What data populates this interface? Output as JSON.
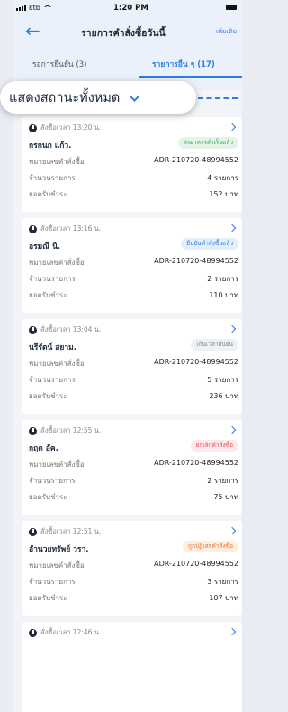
{
  "status_bar": {
    "carrier": "ktb",
    "time": "1:20 PM"
  },
  "nav": {
    "title": "รายการคำสั่งซื้อวันนี้",
    "add_label": "เพิ่มเติม"
  },
  "tabs": [
    {
      "label": "รอการยืนยัน (3)"
    },
    {
      "label": "รายการอื่น ๆ (17)"
    }
  ],
  "filter": {
    "label": "แสดงสถานะทั้งหมด"
  },
  "field_labels": {
    "order_no": "หมายเลขคำสั่งซื้อ",
    "item_count": "จำนวนรายการ",
    "total": "ยอดรับชำระ"
  },
  "orders": [
    {
      "time": "สั่งซื้อเวลา 13:20 น.",
      "name": "กรกนก แก้ว.",
      "status": "ส่งอาหารสำเร็จแล้ว",
      "status_color": "#2eaa5c",
      "status_bg": "#e3f5e9",
      "order_no": "ADR-210720-48994552",
      "items": "4 รายการ",
      "total": "152 บาท"
    },
    {
      "time": "สั่งซื้อเวลา 13:16 น.",
      "name": "อรมณี นิ.",
      "status": "ยืนยันคำสั่งซื้อแล้ว",
      "status_color": "#2f7de1",
      "status_bg": "#e3eefb",
      "order_no": "ADR-210720-48994552",
      "items": "2 รายการ",
      "total": "110 บาท"
    },
    {
      "time": "สั่งซื้อเวลา 13:04 น.",
      "name": "นรีรัตน์ สยาม.",
      "status": "เกินเวลายืนยัน",
      "status_color": "#7a8797",
      "status_bg": "#eef0f3",
      "order_no": "ADR-210720-48994552",
      "items": "5 รายการ",
      "total": "236 บาท"
    },
    {
      "time": "สั่งซื้อเวลา 12:55 น.",
      "name": "กฤต อัค.",
      "status": "ยกเลิกคำสั่งซื้อ",
      "status_color": "#e0505a",
      "status_bg": "#fde8ea",
      "order_no": "ADR-210720-48994552",
      "items": "2 รายการ",
      "total": "75 บาท"
    },
    {
      "time": "สั่งซื้อเวลา 12:51 น.",
      "name": "อำนวยทรัพย์ วรา.",
      "status": "ถูกปฏิเสธคำสั่งซื้อ",
      "status_color": "#f07a2a",
      "status_bg": "#fdeedf",
      "order_no": "ADR-210720-48994552",
      "items": "3 รายการ",
      "total": "107 บาท"
    },
    {
      "time": "สั่งซื้อเวลา 12:46 น.",
      "name": "",
      "status": "",
      "status_color": "#2eaa5c",
      "status_bg": "#e3f5e9",
      "order_no": "",
      "items": "",
      "total": ""
    }
  ],
  "accent_color": "#2f7de1"
}
